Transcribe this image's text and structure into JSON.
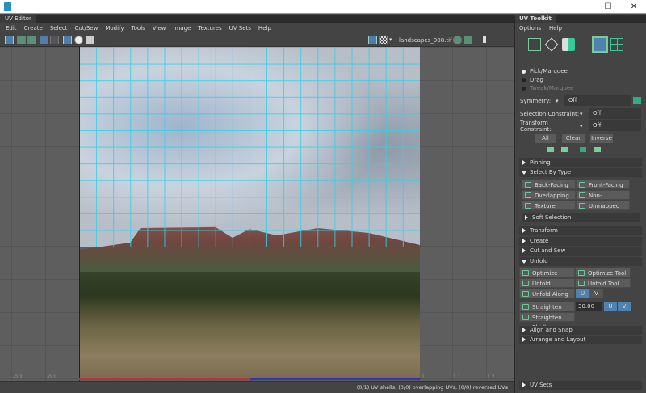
{
  "window": {
    "title": "",
    "minimize": "─",
    "maximize": "☐",
    "close": "✕"
  },
  "editor": {
    "tab": "UV Editor",
    "menu": [
      "Edit",
      "Create",
      "Select",
      "Cut/Sew",
      "Modify",
      "Tools",
      "View",
      "Image",
      "Textures",
      "UV Sets",
      "Help"
    ],
    "image_name": "landscapes_008.tif",
    "ticks": [
      "-0.2",
      "-0.1",
      "1",
      "1.1",
      "1.2"
    ],
    "status": "(0/1) UV shells, (0/0) overlapping UVs, (0/0) reversed UVs"
  },
  "toolkit": {
    "tab": "UV Toolkit",
    "menu": [
      "Options",
      "Help"
    ],
    "tools": [
      "Pick/Marquee",
      "Drag",
      "Tweak/Marquee"
    ],
    "symmetry_label": "Symmetry:",
    "symmetry_value": "Off",
    "selection_constraint_label": "Selection Constraint:",
    "selection_constraint_value": "Off",
    "transform_constraint_label": "Transform Constraint:",
    "transform_constraint_value": "Off",
    "all": "All",
    "clear": "Clear",
    "inverse": "Inverse",
    "pinning": "Pinning",
    "select_by_type": "Select By Type",
    "types": [
      "Back-Facing",
      "Front-Facing",
      "Overlapping",
      "Non-Overlapping",
      "Texture Borders",
      "Unmapped"
    ],
    "soft_selection": "Soft Selection",
    "sections": [
      "Transform",
      "Create",
      "Cut and Sew",
      "Unfold"
    ],
    "unfold": {
      "optimize": "Optimize",
      "optimize_tool": "Optimize Tool",
      "unfold": "Unfold",
      "unfold_tool": "Unfold Tool",
      "unfold_along": "Unfold Along",
      "u": "U",
      "v": "V",
      "straighten_uvs": "Straighten UVs",
      "angle": "30.00",
      "straighten_shell": "Straighten Shell"
    },
    "align_snap": "Align and Snap",
    "arrange_layout": "Arrange and Layout",
    "uv_sets": "UV Sets"
  },
  "colors": {
    "accent": "#4f82ae",
    "grid": "#33d0e8"
  }
}
